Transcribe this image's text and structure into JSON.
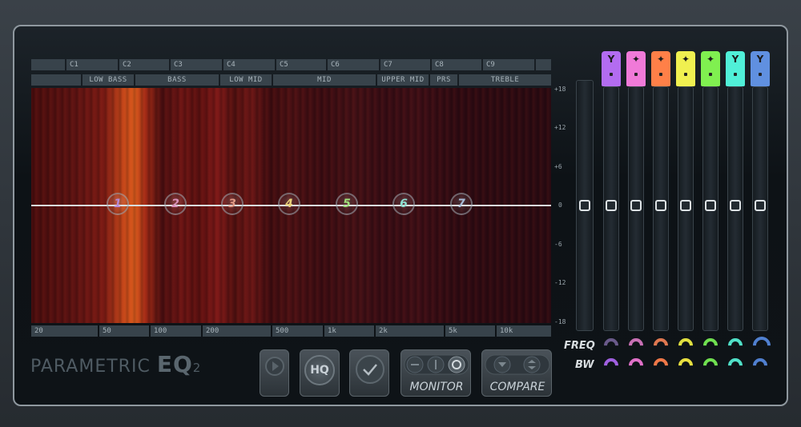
{
  "notes": [
    "C1",
    "C2",
    "C3",
    "C4",
    "C5",
    "C6",
    "C7",
    "C8",
    "C9"
  ],
  "ranges": [
    "LOW BASS",
    "BASS",
    "LOW MID",
    "MID",
    "UPPER MID",
    "PRS",
    "TREBLE"
  ],
  "freqs": [
    "20",
    "50",
    "100",
    "200",
    "500",
    "1k",
    "2k",
    "5k",
    "10k"
  ],
  "db_scale": [
    "+18",
    "+12",
    "+6",
    "0",
    "-6",
    "-12",
    "-18"
  ],
  "bands": [
    {
      "label": "1",
      "color": "#b58ad8"
    },
    {
      "label": "2",
      "color": "#d890b8"
    },
    {
      "label": "3",
      "color": "#e29a86"
    },
    {
      "label": "4",
      "color": "#e8d27a"
    },
    {
      "label": "5",
      "color": "#9ee07a"
    },
    {
      "label": "6",
      "color": "#8ee0d2"
    },
    {
      "label": "7",
      "color": "#a8bcd8"
    }
  ],
  "band_caps": [
    {
      "color": "#b36cf0",
      "symbol": "Y"
    },
    {
      "color": "#f07ad8",
      "symbol": "✦"
    },
    {
      "color": "#ff8048",
      "symbol": "✦"
    },
    {
      "color": "#f0f050",
      "symbol": "✦"
    },
    {
      "color": "#80f050",
      "symbol": "✦"
    },
    {
      "color": "#50f0d8",
      "symbol": "Y"
    },
    {
      "color": "#6090e0",
      "symbol": "Y"
    }
  ],
  "labels": {
    "freq": "FREQ",
    "bw": "BW"
  },
  "brand": {
    "name": "PARAMETRIC",
    "eq": "EQ",
    "num": "2"
  },
  "buttons": {
    "hq": "HQ",
    "monitor": "MONITOR",
    "compare": "COMPARE"
  }
}
